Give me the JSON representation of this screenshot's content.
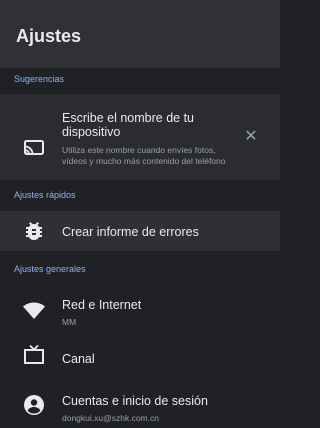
{
  "header": {
    "title": "Ajustes"
  },
  "sections": {
    "suggestions": "Sugerencias",
    "quick": "Ajustes rápidos",
    "general": "Ajustes generales"
  },
  "suggestion": {
    "title_line1": "Escribe el nombre de tu",
    "title_line2": "dispositivo",
    "desc_line1": "Utiliza este nombre cuando envíes fotos,",
    "desc_line2": "vídeos y mucho más contenido del teléfono",
    "icon": "cast-icon",
    "dismiss_icon": "close-icon"
  },
  "quick_items": [
    {
      "label": "Crear informe de errores",
      "icon": "bug-icon"
    }
  ],
  "general_items": [
    {
      "label": "Red e Internet",
      "sub": "MM",
      "icon": "wifi-icon"
    },
    {
      "label": "Canal",
      "sub": "",
      "icon": "tv-icon"
    },
    {
      "label": "Cuentas e inicio de sesión",
      "sub": "dongkui.xu@szhk.com.cn",
      "icon": "account-icon"
    }
  ],
  "colors": {
    "background": "#1f2124",
    "header": "#303134",
    "section_accent": "#8ab4f8",
    "highlight_row": "#2a2c2f"
  }
}
